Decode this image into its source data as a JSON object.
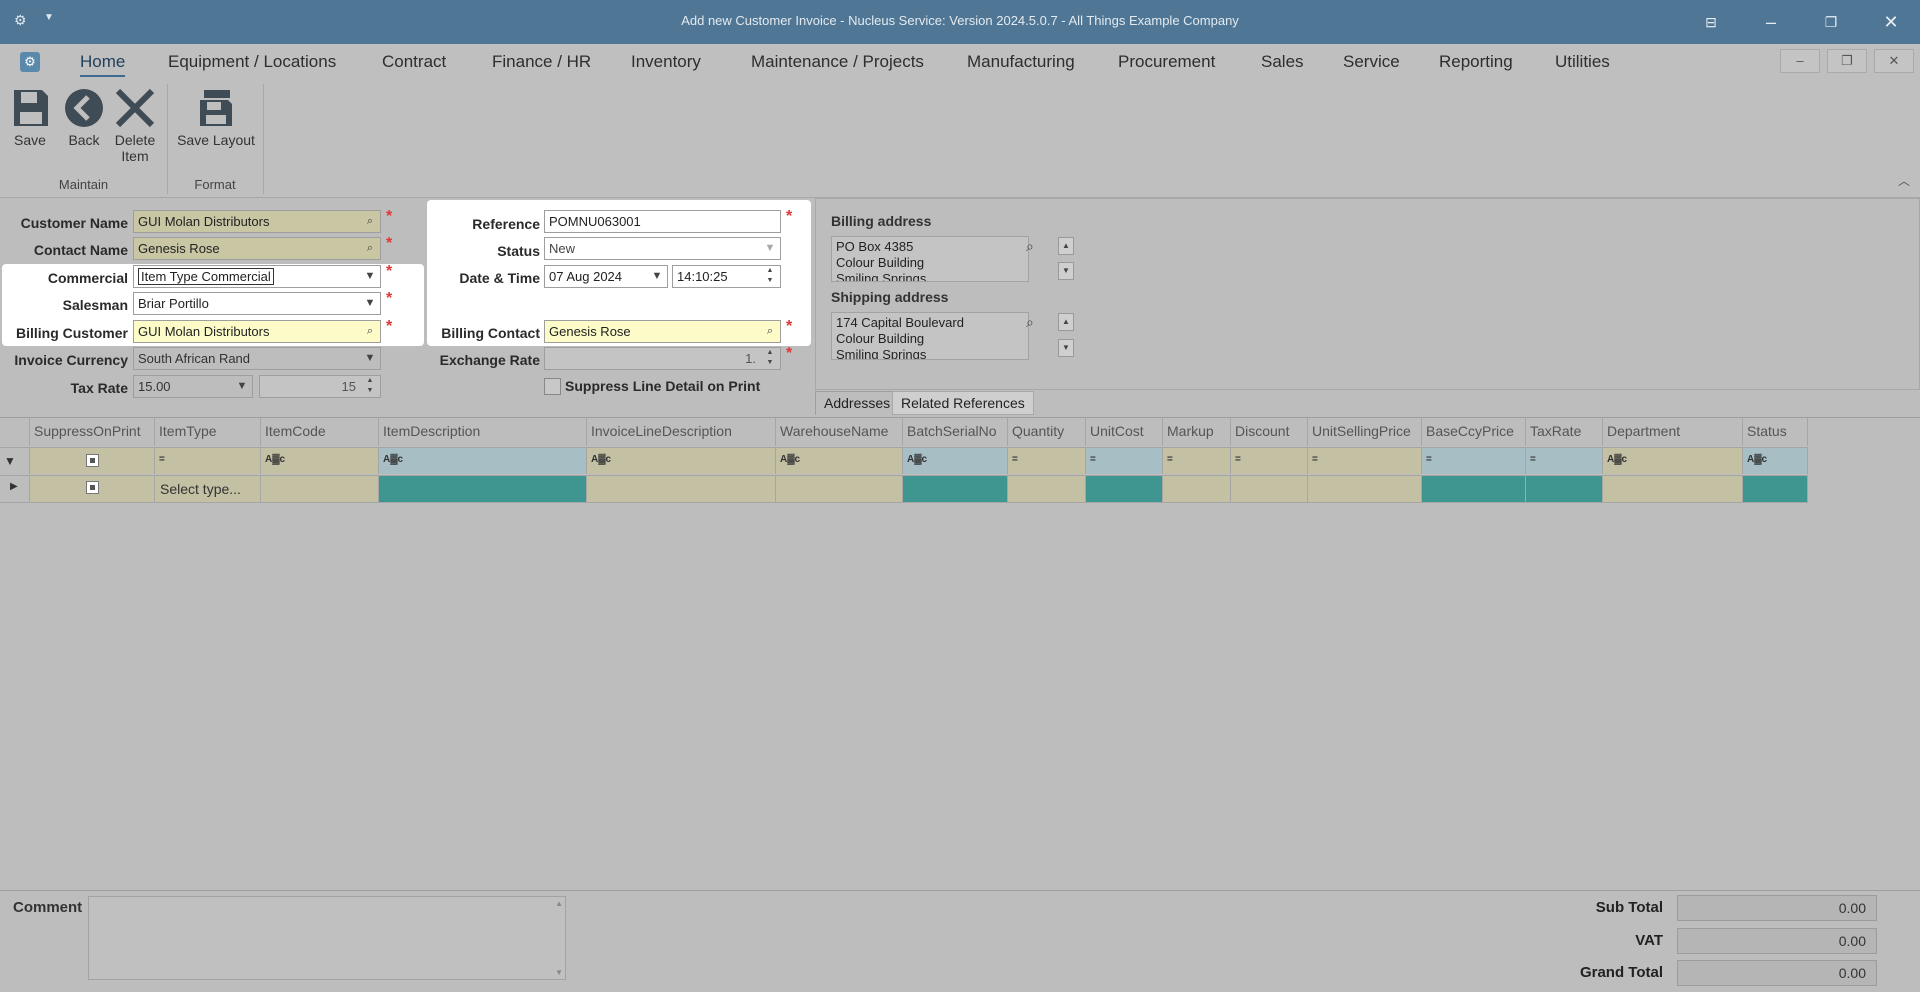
{
  "window": {
    "title": "Add new Customer Invoice - Nucleus Service: Version 2024.5.0.7 - All Things Example Company"
  },
  "menu": {
    "items": [
      "Home",
      "Equipment / Locations",
      "Contract",
      "Finance / HR",
      "Inventory",
      "Maintenance / Projects",
      "Manufacturing",
      "Procurement",
      "Sales",
      "Service",
      "Reporting",
      "Utilities"
    ]
  },
  "ribbon": {
    "save": "Save",
    "back": "Back",
    "delete": "Delete Item",
    "save_layout": "Save Layout",
    "group_maintain": "Maintain",
    "group_format": "Format"
  },
  "form": {
    "customer_name_label": "Customer Name",
    "customer_name": "GUI Molan Distributors",
    "contact_name_label": "Contact Name",
    "contact_name": "Genesis Rose",
    "commercial_label": "Commercial",
    "commercial": "Item Type Commercial",
    "salesman_label": "Salesman",
    "salesman": "Briar Portillo",
    "billing_customer_label": "Billing Customer",
    "billing_customer": "GUI Molan Distributors",
    "invoice_currency_label": "Invoice Currency",
    "invoice_currency": "South African Rand",
    "tax_rate_label": "Tax Rate",
    "tax_rate": "15.00",
    "tax_rate_value": "15",
    "reference_label": "Reference",
    "reference": "POMNU063001",
    "status_label": "Status",
    "status": "New",
    "datetime_label": "Date & Time",
    "date": "07 Aug 2024",
    "time": "14:10:25",
    "billing_contact_label": "Billing Contact",
    "billing_contact": "Genesis Rose",
    "exchange_rate_label": "Exchange Rate",
    "exchange_rate": "1.",
    "suppress_label": "Suppress Line Detail on Print"
  },
  "addresses": {
    "billing_label": "Billing address",
    "billing_lines": [
      "PO Box 4385",
      "Colour Building",
      "Smiling Springs"
    ],
    "shipping_label": "Shipping address",
    "shipping_lines": [
      "174 Capital Boulevard",
      "Colour Building",
      "Smiling Springs"
    ]
  },
  "tabs": [
    "Addresses",
    "Related References"
  ],
  "grid": {
    "columns": [
      "SuppressOnPrint",
      "ItemType",
      "ItemCode",
      "ItemDescription",
      "InvoiceLineDescription",
      "WarehouseName",
      "BatchSerialNo",
      "Quantity",
      "UnitCost",
      "Markup",
      "Discount",
      "UnitSellingPrice",
      "BaseCcyPrice",
      "TaxRate",
      "Department",
      "Status"
    ],
    "filter_equals": "=",
    "filter_contains": "A▓c",
    "new_row_itemtype": "Select type..."
  },
  "footer": {
    "comment_label": "Comment",
    "subtotal_label": "Sub Total",
    "subtotal": "0.00",
    "vat_label": "VAT",
    "vat": "0.00",
    "grand_total_label": "Grand Total",
    "grand_total": "0.00"
  },
  "colors": {
    "titlebar": "#4f7694",
    "required": "#e23636",
    "teal_cell": "#3f9590"
  }
}
